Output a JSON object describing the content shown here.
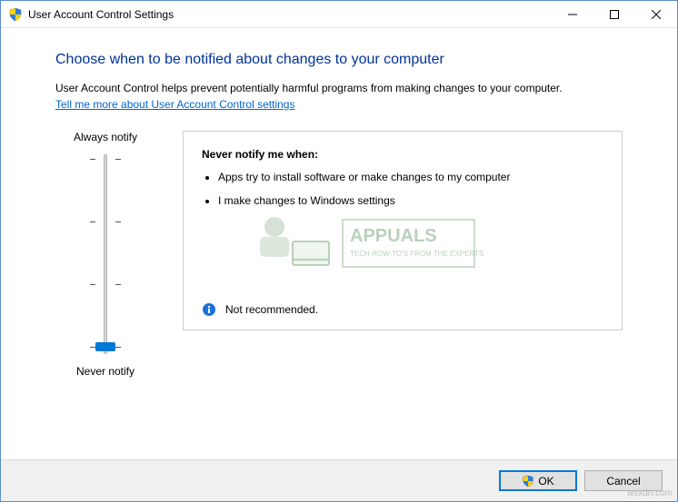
{
  "window": {
    "title": "User Account Control Settings"
  },
  "content": {
    "heading": "Choose when to be notified about changes to your computer",
    "description": "User Account Control helps prevent potentially harmful programs from making changes to your computer.",
    "help_link": "Tell me more about User Account Control settings"
  },
  "slider": {
    "top_label": "Always notify",
    "bottom_label": "Never notify",
    "levels": 4,
    "current_level": 0
  },
  "detail": {
    "title": "Never notify me when:",
    "bullets": [
      "Apps try to install software or make changes to my computer",
      "I make changes to Windows settings"
    ],
    "recommendation": "Not recommended."
  },
  "buttons": {
    "ok": "OK",
    "cancel": "Cancel"
  },
  "watermark": {
    "brand": "APPUALS",
    "tagline": "TECH HOW-TO'S FROM THE EXPERTS!"
  },
  "site_watermark": "wsxdn.com",
  "icons": {
    "shield": "uac-shield-icon",
    "info": "info-icon",
    "minimize": "minimize-icon",
    "maximize": "maximize-icon",
    "close": "close-icon"
  }
}
